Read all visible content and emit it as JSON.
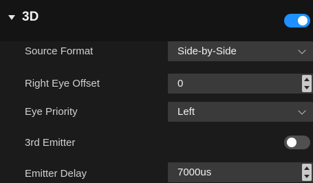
{
  "section": {
    "title": "3D",
    "enabled": true
  },
  "colors": {
    "accent": "#1e90ff",
    "toggle_off": "#505050"
  },
  "rows": [
    {
      "label": "Source Format",
      "type": "dropdown",
      "value": "Side-by-Side"
    },
    {
      "label": "Right Eye Offset",
      "type": "stepper",
      "value": "0"
    },
    {
      "label": "Eye Priority",
      "type": "dropdown",
      "value": "Left"
    },
    {
      "label": "3rd Emitter",
      "type": "toggle",
      "enabled": false
    },
    {
      "label": "Emitter Delay",
      "type": "stepper",
      "value": "7000us"
    }
  ]
}
